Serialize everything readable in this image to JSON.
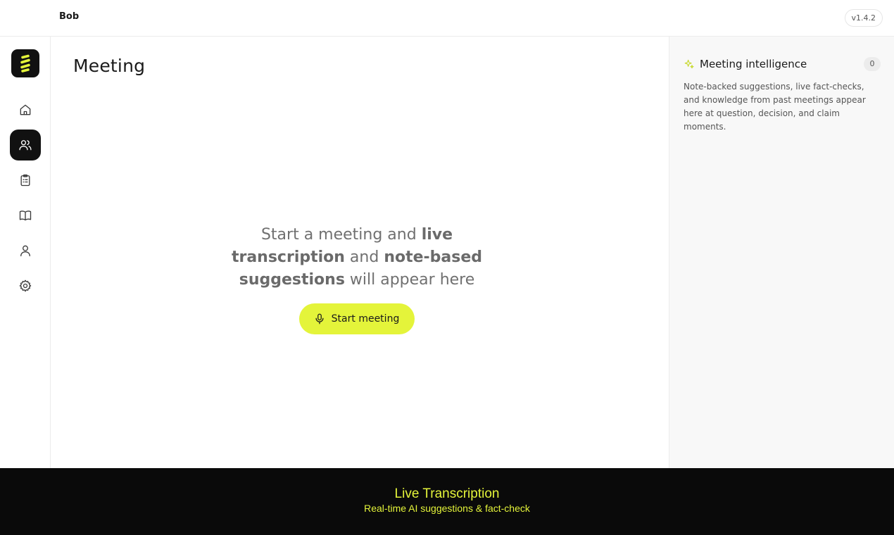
{
  "header": {
    "user_name": "Bob",
    "version": "v1.4.2"
  },
  "sidebar": {
    "logo": "brand-logo",
    "items": [
      {
        "id": "home",
        "icon": "home-icon",
        "active": false
      },
      {
        "id": "meeting",
        "icon": "users-icon",
        "active": true
      },
      {
        "id": "tasks",
        "icon": "clipboard-icon",
        "active": false
      },
      {
        "id": "knowledge",
        "icon": "book-icon",
        "active": false
      },
      {
        "id": "profile",
        "icon": "user-icon",
        "active": false
      },
      {
        "id": "settings",
        "icon": "gear-icon",
        "active": false
      }
    ]
  },
  "main": {
    "title": "Meeting",
    "empty_state": {
      "text_1": "Start a meeting and ",
      "bold_1": "live transcription",
      "text_2": " and ",
      "bold_2": "note-based suggestions",
      "text_3": " will appear here"
    },
    "start_button_label": "Start meeting"
  },
  "intelligence_panel": {
    "title": "Meeting intelligence",
    "count": "0",
    "description": "Note-backed suggestions, live fact-checks, and knowledge from past meetings appear here at question, decision, and claim moments."
  },
  "footer": {
    "title": "Live Transcription",
    "subtitle": "Real-time AI suggestions & fact-check"
  },
  "colors": {
    "accent": "#e4f43a",
    "active_nav": "#111111",
    "footer_bg": "#0a0a0a",
    "panel_bg": "#f8f8f8"
  }
}
